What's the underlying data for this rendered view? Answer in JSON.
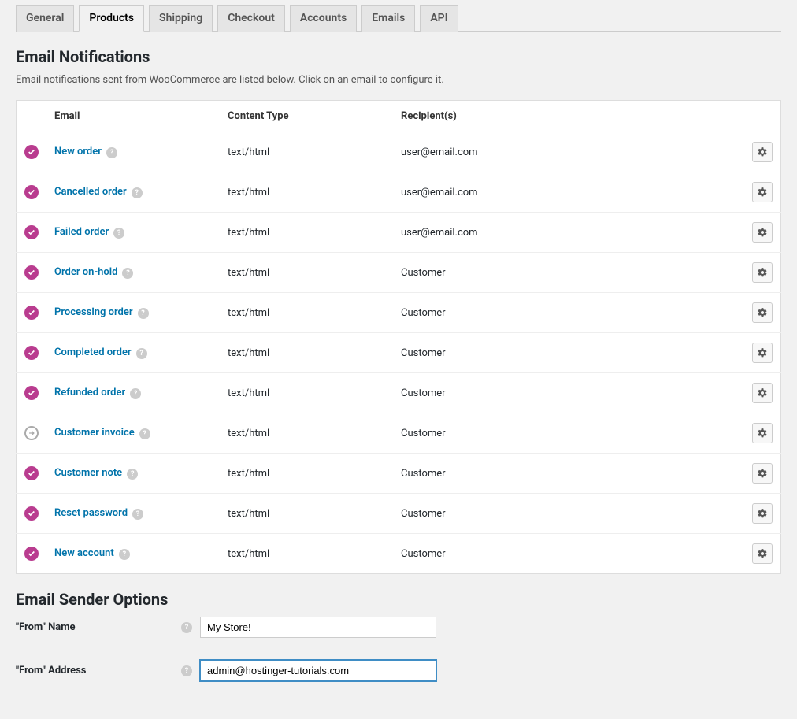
{
  "tabs": [
    {
      "label": "General",
      "active": false
    },
    {
      "label": "Products",
      "active": true
    },
    {
      "label": "Shipping",
      "active": false
    },
    {
      "label": "Checkout",
      "active": false
    },
    {
      "label": "Accounts",
      "active": false
    },
    {
      "label": "Emails",
      "active": false
    },
    {
      "label": "API",
      "active": false
    }
  ],
  "notifications": {
    "heading": "Email Notifications",
    "description": "Email notifications sent from WooCommerce are listed below. Click on an email to configure it.",
    "columns": {
      "email": "Email",
      "content_type": "Content Type",
      "recipients": "Recipient(s)"
    },
    "rows": [
      {
        "status": "enabled",
        "name": "New order",
        "content_type": "text/html",
        "recipient": "user@email.com"
      },
      {
        "status": "enabled",
        "name": "Cancelled order",
        "content_type": "text/html",
        "recipient": "user@email.com"
      },
      {
        "status": "enabled",
        "name": "Failed order",
        "content_type": "text/html",
        "recipient": "user@email.com"
      },
      {
        "status": "enabled",
        "name": "Order on-hold",
        "content_type": "text/html",
        "recipient": "Customer"
      },
      {
        "status": "enabled",
        "name": "Processing order",
        "content_type": "text/html",
        "recipient": "Customer"
      },
      {
        "status": "enabled",
        "name": "Completed order",
        "content_type": "text/html",
        "recipient": "Customer"
      },
      {
        "status": "enabled",
        "name": "Refunded order",
        "content_type": "text/html",
        "recipient": "Customer"
      },
      {
        "status": "manual",
        "name": "Customer invoice",
        "content_type": "text/html",
        "recipient": "Customer"
      },
      {
        "status": "enabled",
        "name": "Customer note",
        "content_type": "text/html",
        "recipient": "Customer"
      },
      {
        "status": "enabled",
        "name": "Reset password",
        "content_type": "text/html",
        "recipient": "Customer"
      },
      {
        "status": "enabled",
        "name": "New account",
        "content_type": "text/html",
        "recipient": "Customer"
      }
    ]
  },
  "sender": {
    "heading": "Email Sender Options",
    "from_name_label": "\"From\" Name",
    "from_name_value": "My Store!",
    "from_address_label": "\"From\" Address",
    "from_address_value": "admin@hostinger-tutorials.com"
  }
}
